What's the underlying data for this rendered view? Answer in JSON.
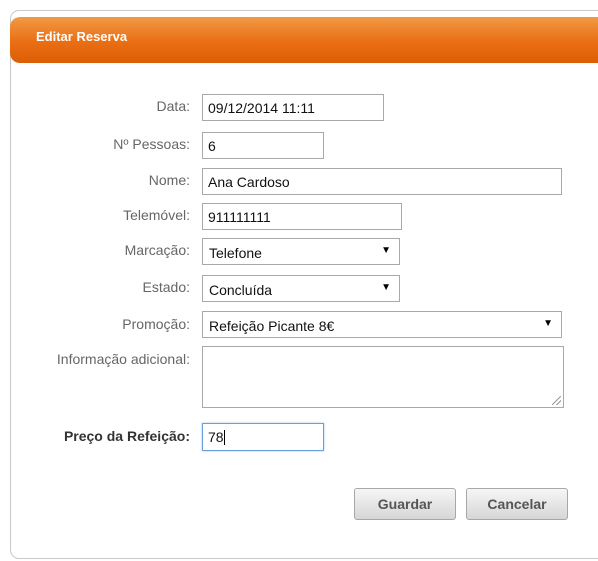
{
  "dialog": {
    "title": "Editar Reserva"
  },
  "form": {
    "data_label": "Data:",
    "data_value": "09/12/2014 11:11",
    "pessoas_label": "Nº Pessoas:",
    "pessoas_value": "6",
    "nome_label": "Nome:",
    "nome_value": "Ana Cardoso",
    "telemovel_label": "Telemóvel:",
    "telemovel_value": "911111111",
    "marcacao_label": "Marcação:",
    "marcacao_value": "Telefone",
    "estado_label": "Estado:",
    "estado_value": "Concluída",
    "promocao_label": "Promoção:",
    "promocao_value": "Refeição Picante 8€",
    "info_label": "Informação adicional:",
    "info_value": "",
    "preco_label": "Preço da Refeição:",
    "preco_value": "78"
  },
  "buttons": {
    "guardar": "Guardar",
    "cancelar": "Cancelar"
  },
  "icons": {
    "dropdown": "chevron-down-icon",
    "resize": "resize-grip-icon"
  }
}
